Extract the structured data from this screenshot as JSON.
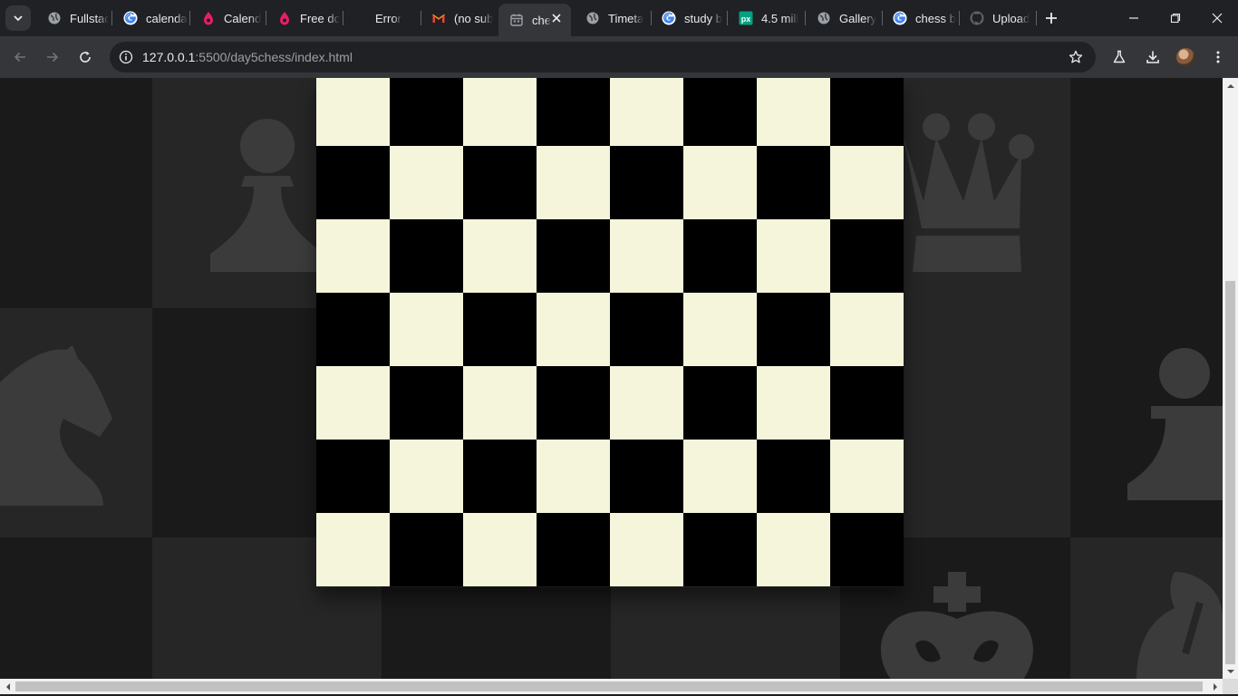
{
  "tabs": [
    {
      "title": "Fullstac",
      "favicon": "globe-icon"
    },
    {
      "title": "calenda",
      "favicon": "google-icon"
    },
    {
      "title": "Calend",
      "favicon": "drop-icon"
    },
    {
      "title": "Free dc",
      "favicon": "drop-icon"
    },
    {
      "title": "Error",
      "favicon": "none"
    },
    {
      "title": "(no sub",
      "favicon": "gmail-icon"
    },
    {
      "title": "che",
      "favicon": "calendar-icon",
      "active": true
    },
    {
      "title": "Timeta",
      "favicon": "globe-icon"
    },
    {
      "title": "study b",
      "favicon": "google-icon"
    },
    {
      "title": "4.5 mill",
      "favicon": "px-icon"
    },
    {
      "title": "Gallery",
      "favicon": "globe-icon"
    },
    {
      "title": "chess b",
      "favicon": "google-icon"
    },
    {
      "title": "Upload",
      "favicon": "github-icon"
    }
  ],
  "address_bar": {
    "host": "127.0.0.1",
    "path": ":5500/day5chess/index.html"
  },
  "board": {
    "rows": 7,
    "cols": 8,
    "light_color": "#f5f5dc",
    "dark_color": "#000000"
  },
  "colors": {
    "chrome_dark": "#202124",
    "toolbar": "#35363a",
    "bg_tile_a": "#1a1a1a",
    "bg_tile_b": "#262626",
    "bg_piece": "#3b3b3b"
  }
}
